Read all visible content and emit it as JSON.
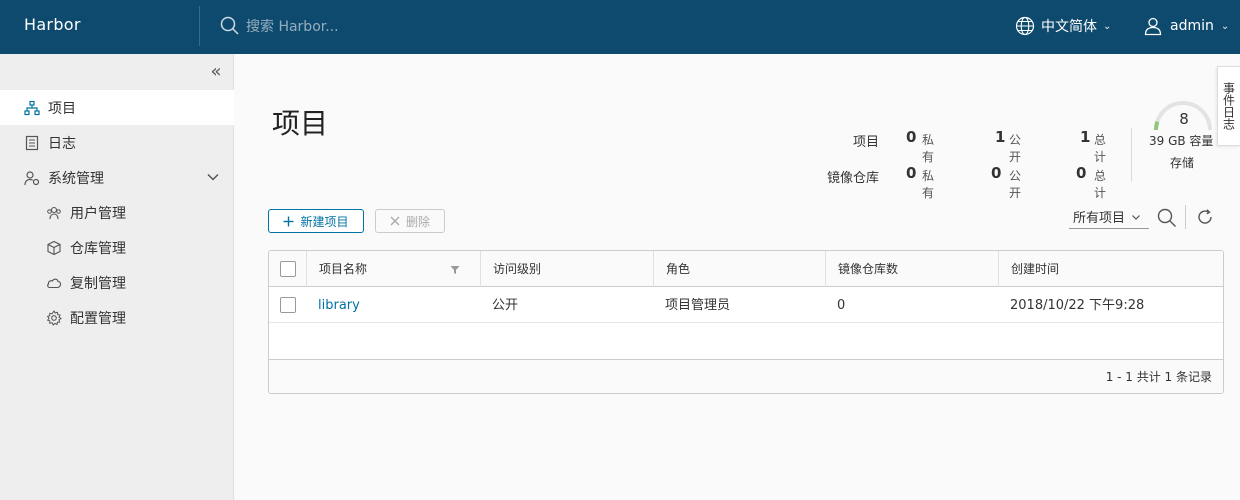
{
  "header": {
    "brand": "Harbor",
    "search_placeholder": "搜索 Harbor...",
    "language": "中文简体",
    "user": "admin"
  },
  "sidebar": {
    "items": [
      {
        "label": "项目",
        "icon": "project-icon",
        "active": true
      },
      {
        "label": "日志",
        "icon": "log-icon"
      },
      {
        "label": "系统管理",
        "icon": "admin-icon",
        "expanded": true
      },
      {
        "label": "用户管理",
        "icon": "users-icon"
      },
      {
        "label": "仓库管理",
        "icon": "cube-icon"
      },
      {
        "label": "复制管理",
        "icon": "cloud-icon"
      },
      {
        "label": "配置管理",
        "icon": "gear-icon"
      }
    ]
  },
  "main": {
    "title": "项目",
    "stats": {
      "projects_label": "项目",
      "repos_label": "镜像仓库",
      "private_label": "私有",
      "public_label": "公开",
      "total_label": "总计",
      "projects": {
        "private": "0",
        "public": "1",
        "total": "1"
      },
      "repos": {
        "private": "0",
        "public": "0",
        "total": "0"
      }
    },
    "storage": {
      "count": "8",
      "capacity": "39 GB 容量",
      "label": "存储",
      "used_fraction": 0.1
    },
    "event_log_tab": "事件日志",
    "toolbar": {
      "new_label": "新建项目",
      "delete_label": "删除",
      "filter_value": "所有项目"
    },
    "table": {
      "columns": [
        "项目名称",
        "访问级别",
        "角色",
        "镜像仓库数",
        "创建时间"
      ],
      "rows": [
        {
          "name": "library",
          "access": "公开",
          "role": "项目管理员",
          "repos": "0",
          "created": "2018/10/22 下午9:28"
        }
      ],
      "footer": "1 - 1 共计 1 条记录"
    }
  },
  "colors": {
    "header_bg": "#0e4a6e",
    "accent": "#0072a3",
    "gauge": "#8fc87a"
  }
}
